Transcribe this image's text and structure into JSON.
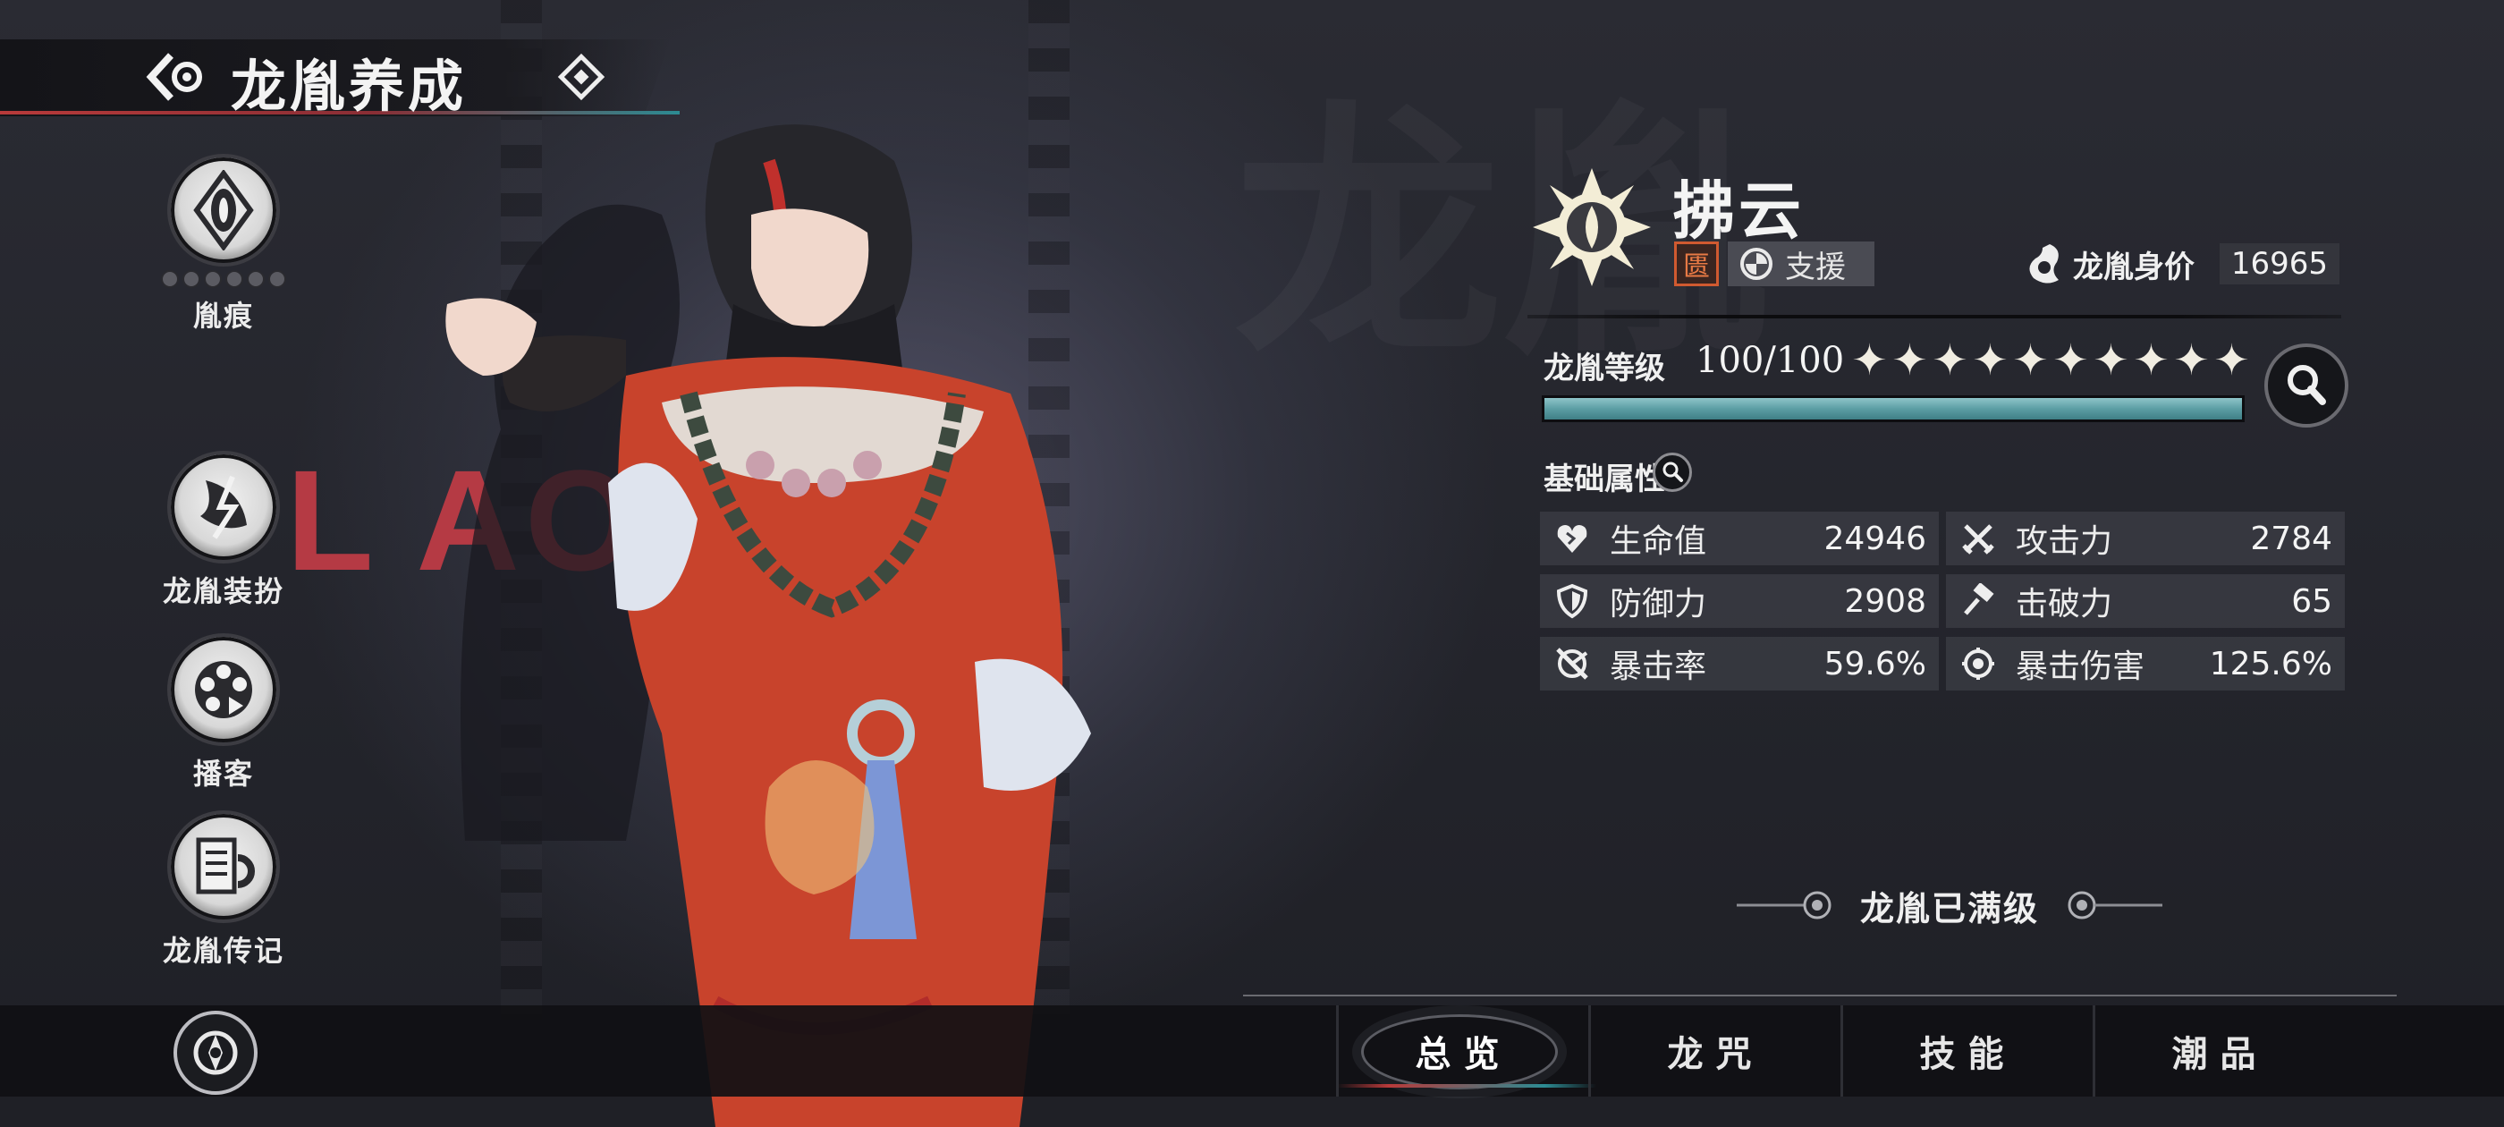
{
  "header": {
    "title": "龙胤养成"
  },
  "left_menu": [
    {
      "label": "胤痕",
      "icon": "mark-eye-icon",
      "pips": 6
    },
    {
      "label": "龙胤装扮",
      "icon": "outfit-icon"
    },
    {
      "label": "播客",
      "icon": "film-reel-icon"
    },
    {
      "label": "龙胤传记",
      "icon": "biography-icon"
    }
  ],
  "background": {
    "word": "L     AO"
  },
  "character": {
    "name": "拂云",
    "seal": "匮",
    "role": "支援",
    "worth_label": "龙胤身价",
    "worth_value": "16965"
  },
  "level": {
    "label": "龙胤等级",
    "value": "100/100",
    "stars": 10,
    "progress": 1.0
  },
  "attributes": {
    "title": "基础属性",
    "stats": [
      {
        "name": "生命值",
        "value": "24946",
        "icon": "heart-icon"
      },
      {
        "name": "攻击力",
        "value": "2784",
        "icon": "crossed-swords-icon"
      },
      {
        "name": "防御力",
        "value": "2908",
        "icon": "shield-icon"
      },
      {
        "name": "击破力",
        "value": "65",
        "icon": "hammer-icon"
      },
      {
        "name": "暴击率",
        "value": "59.6%",
        "icon": "crit-rate-icon"
      },
      {
        "name": "暴击伤害",
        "value": "125.6%",
        "icon": "crit-damage-icon"
      }
    ]
  },
  "max_level_text": "龙胤已满级",
  "tabs": [
    {
      "label": "总览",
      "active": true
    },
    {
      "label": "龙咒",
      "active": false
    },
    {
      "label": "技能",
      "active": false
    },
    {
      "label": "潮品",
      "active": false
    }
  ],
  "colors": {
    "accent_red": "#b83a3a",
    "accent_teal": "#2c8b93",
    "bar_fill": "#5c9ea4",
    "seal_orange": "#e87a45"
  }
}
